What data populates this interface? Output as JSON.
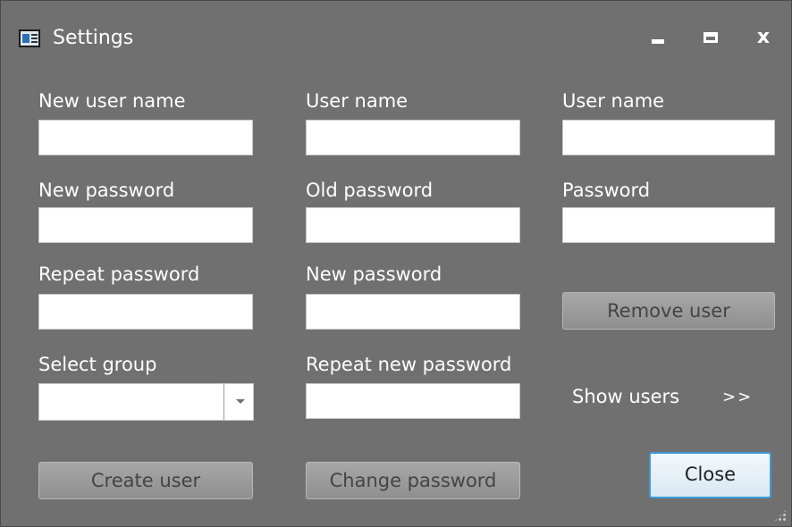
{
  "window": {
    "title": "Settings",
    "close_glyph": "x",
    "icons": {
      "app": "window-app-icon",
      "minimize": "minimize-icon",
      "maximize": "maximize-icon",
      "close": "close-icon",
      "grip": "resize-grip-icon"
    }
  },
  "create_user": {
    "username_label": "New user name",
    "username_value": "",
    "password_label": "New password",
    "password_value": "",
    "repeat_label": "Repeat password",
    "repeat_value": "",
    "group_label": "Select group",
    "group_value": "",
    "button_label": "Create user"
  },
  "change_password": {
    "username_label": "User name",
    "username_value": "",
    "old_label": "Old password",
    "old_value": "",
    "new_label": "New password",
    "new_value": "",
    "repeat_label": "Repeat new password",
    "repeat_value": "",
    "button_label": "Change password"
  },
  "remove_user": {
    "username_label": "User name",
    "username_value": "",
    "password_label": "Password",
    "password_value": "",
    "button_label": "Remove user"
  },
  "show_users": {
    "label": "Show users",
    "toggle": ">>"
  },
  "close_button": "Close",
  "colors": {
    "window_bg": "#707070",
    "button_bg": "#9d9d9d",
    "close_border": "#3c9ad9"
  }
}
